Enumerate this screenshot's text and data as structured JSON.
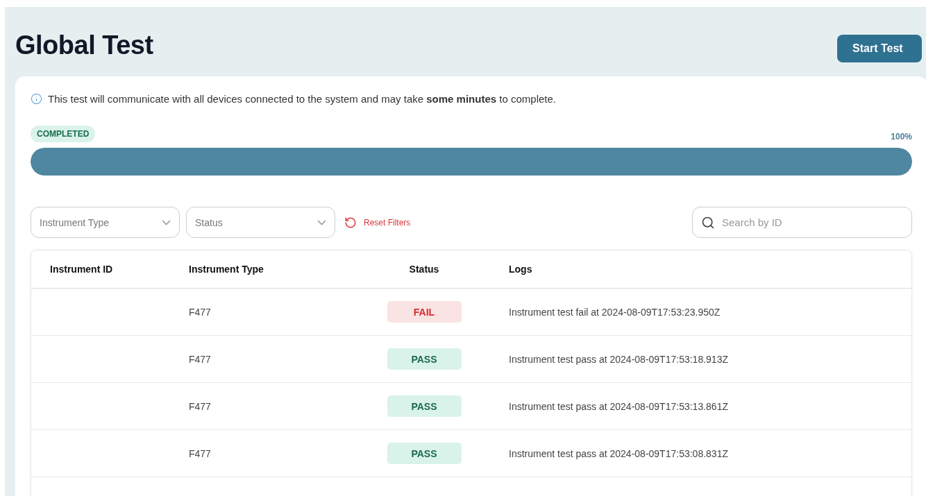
{
  "page": {
    "title": "Global Test",
    "action_button": "Start Test"
  },
  "notice": {
    "text": "This test will communicate with all devices connected to the system and may take **some minutes** to complete."
  },
  "progress": {
    "status": "COMPLETED",
    "percent": "100%",
    "level": 1
  },
  "filters": [
    {
      "placeholder": "Instrument Type"
    },
    {
      "placeholder": "Status"
    }
  ],
  "reset_filters": "Reset Filters",
  "search": {
    "placeholder": "Search by ID"
  },
  "table": {
    "columns": [
      "Instrument ID",
      "Instrument Type",
      "Status",
      "Logs"
    ],
    "rows": [
      {
        "instrument_type": "F477",
        "status": {
          "label": "FAIL",
          "kind": "fail"
        },
        "log": "Instrument test fail at 2024-08-09T17:53:23.950Z"
      },
      {
        "instrument_type": "F477",
        "status": {
          "label": "PASS",
          "kind": "pass"
        },
        "log": "Instrument test pass at 2024-08-09T17:53:18.913Z"
      },
      {
        "instrument_type": "F477",
        "status": {
          "label": "PASS",
          "kind": "pass"
        },
        "log": "Instrument test pass at 2024-08-09T17:53:13.861Z"
      },
      {
        "instrument_type": "F477",
        "status": {
          "label": "PASS",
          "kind": "pass"
        },
        "log": "Instrument test pass at 2024-08-09T17:53:08.831Z"
      }
    ]
  }
}
